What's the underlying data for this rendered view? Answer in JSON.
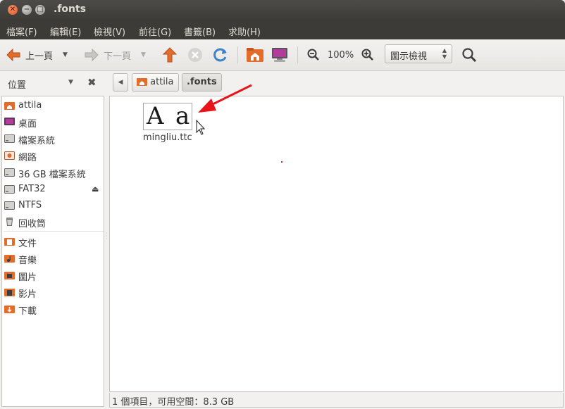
{
  "window": {
    "title": ".fonts"
  },
  "menubar": {
    "items": [
      "檔案(F)",
      "編輯(E)",
      "檢視(V)",
      "前往(G)",
      "書籤(B)",
      "求助(H)"
    ]
  },
  "toolbar": {
    "back_label": "上一頁",
    "forward_label": "下一頁",
    "zoom_level": "100%",
    "view_mode": "圖示檢視"
  },
  "sidebar": {
    "title": "位置",
    "places": [
      {
        "label": "attila",
        "icon": "home-folder-icon"
      },
      {
        "label": "桌面",
        "icon": "desktop-icon"
      },
      {
        "label": "檔案系統",
        "icon": "drive-icon"
      },
      {
        "label": "網路",
        "icon": "network-icon"
      },
      {
        "label": "36 GB 檔案系統",
        "icon": "drive-icon"
      },
      {
        "label": "FAT32",
        "icon": "drive-icon"
      },
      {
        "label": "NTFS",
        "icon": "drive-icon"
      },
      {
        "label": "回收筒",
        "icon": "trash-icon"
      }
    ],
    "bookmarks": [
      {
        "label": "文件",
        "icon": "documents-folder-icon"
      },
      {
        "label": "音樂",
        "icon": "music-folder-icon"
      },
      {
        "label": "圖片",
        "icon": "pictures-folder-icon"
      },
      {
        "label": "影片",
        "icon": "videos-folder-icon"
      },
      {
        "label": "下載",
        "icon": "downloads-folder-icon"
      }
    ]
  },
  "pathbar": {
    "crumbs": [
      {
        "label": "attila",
        "icon": "home-folder-icon"
      },
      {
        "label": ".fonts"
      }
    ]
  },
  "files": [
    {
      "name": "mingliu.ttc",
      "thumb_upper": "A",
      "thumb_lower": "a"
    }
  ],
  "status": {
    "text": "1 個項目，可用空間：8.3 GB"
  },
  "colors": {
    "titlebar": "#3c3b37",
    "accent_orange": "#e46c2b",
    "annotation_arrow": "#e8141a"
  }
}
